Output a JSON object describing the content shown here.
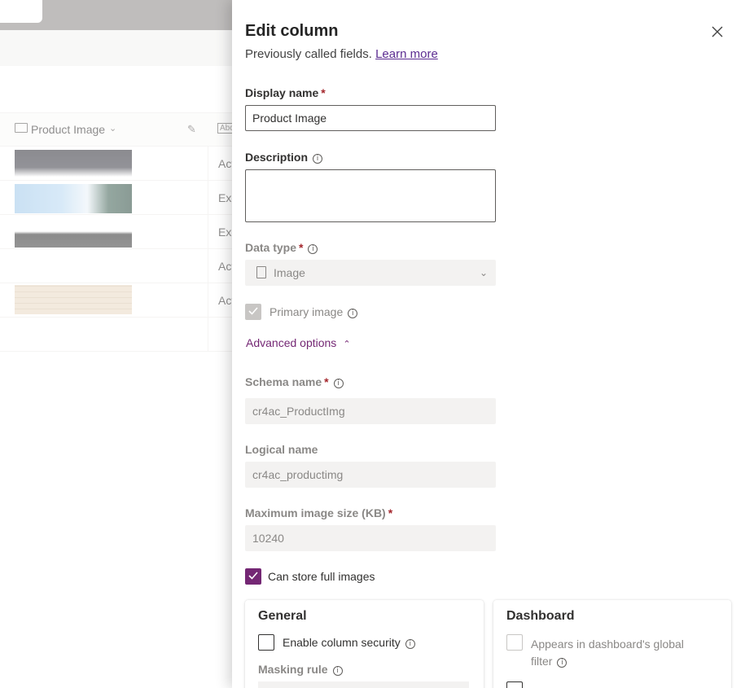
{
  "background": {
    "column_header": {
      "label": "Product Image",
      "icon": "image-icon",
      "chevron": "chevron-down-icon"
    },
    "rows": [
      {
        "status": "Act"
      },
      {
        "status": "Exp"
      },
      {
        "status": "Exp"
      },
      {
        "status": "Act"
      },
      {
        "status": "Act"
      }
    ]
  },
  "panel": {
    "title": "Edit column",
    "subtitle": "Previously called fields.",
    "learn_more": "Learn more",
    "display_name": {
      "label": "Display name",
      "required": "*",
      "value": "Product Image"
    },
    "description": {
      "label": "Description",
      "value": ""
    },
    "data_type": {
      "label": "Data type",
      "required": "*",
      "value": "Image"
    },
    "primary_image": {
      "label": "Primary image",
      "checked": true
    },
    "advanced_options": {
      "label": "Advanced options"
    },
    "schema_name": {
      "label": "Schema name",
      "required": "*",
      "value": "cr4ac_ProductImg"
    },
    "logical_name": {
      "label": "Logical name",
      "value": "cr4ac_productimg"
    },
    "max_image_size": {
      "label": "Maximum image size (KB)",
      "required": "*",
      "value": "10240"
    },
    "can_store_full": {
      "label": "Can store full images",
      "checked": true
    },
    "general": {
      "title": "General",
      "enable_security": "Enable column security",
      "masking_rule": "Masking rule"
    },
    "dashboard": {
      "title": "Dashboard",
      "appears_line1": "Appears in dashboard's global",
      "appears_line2": "filter"
    }
  },
  "colors": {
    "accent": "#742774",
    "link": "#5c2d91",
    "required": "#a4262c"
  }
}
